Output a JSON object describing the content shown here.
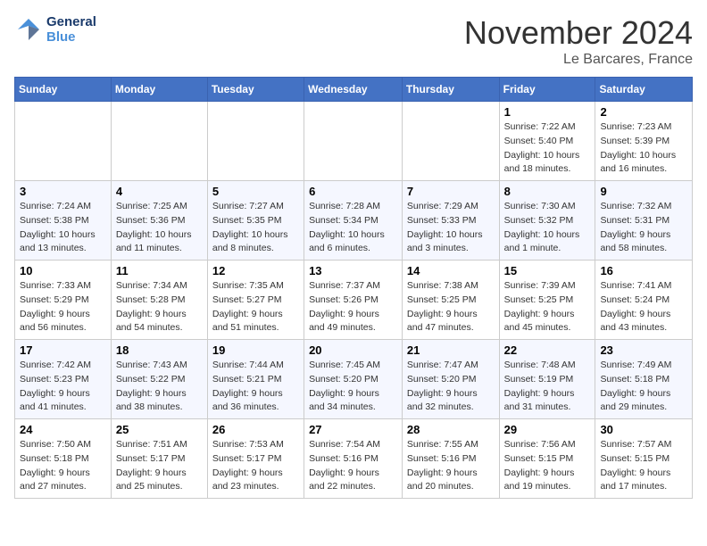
{
  "header": {
    "logo_line1": "General",
    "logo_line2": "Blue",
    "month_title": "November 2024",
    "location": "Le Barcares, France"
  },
  "days_of_week": [
    "Sunday",
    "Monday",
    "Tuesday",
    "Wednesday",
    "Thursday",
    "Friday",
    "Saturday"
  ],
  "weeks": [
    {
      "days": [
        {
          "num": "",
          "info": ""
        },
        {
          "num": "",
          "info": ""
        },
        {
          "num": "",
          "info": ""
        },
        {
          "num": "",
          "info": ""
        },
        {
          "num": "",
          "info": ""
        },
        {
          "num": "1",
          "info": "Sunrise: 7:22 AM\nSunset: 5:40 PM\nDaylight: 10 hours and 18 minutes."
        },
        {
          "num": "2",
          "info": "Sunrise: 7:23 AM\nSunset: 5:39 PM\nDaylight: 10 hours and 16 minutes."
        }
      ]
    },
    {
      "days": [
        {
          "num": "3",
          "info": "Sunrise: 7:24 AM\nSunset: 5:38 PM\nDaylight: 10 hours and 13 minutes."
        },
        {
          "num": "4",
          "info": "Sunrise: 7:25 AM\nSunset: 5:36 PM\nDaylight: 10 hours and 11 minutes."
        },
        {
          "num": "5",
          "info": "Sunrise: 7:27 AM\nSunset: 5:35 PM\nDaylight: 10 hours and 8 minutes."
        },
        {
          "num": "6",
          "info": "Sunrise: 7:28 AM\nSunset: 5:34 PM\nDaylight: 10 hours and 6 minutes."
        },
        {
          "num": "7",
          "info": "Sunrise: 7:29 AM\nSunset: 5:33 PM\nDaylight: 10 hours and 3 minutes."
        },
        {
          "num": "8",
          "info": "Sunrise: 7:30 AM\nSunset: 5:32 PM\nDaylight: 10 hours and 1 minute."
        },
        {
          "num": "9",
          "info": "Sunrise: 7:32 AM\nSunset: 5:31 PM\nDaylight: 9 hours and 58 minutes."
        }
      ]
    },
    {
      "days": [
        {
          "num": "10",
          "info": "Sunrise: 7:33 AM\nSunset: 5:29 PM\nDaylight: 9 hours and 56 minutes."
        },
        {
          "num": "11",
          "info": "Sunrise: 7:34 AM\nSunset: 5:28 PM\nDaylight: 9 hours and 54 minutes."
        },
        {
          "num": "12",
          "info": "Sunrise: 7:35 AM\nSunset: 5:27 PM\nDaylight: 9 hours and 51 minutes."
        },
        {
          "num": "13",
          "info": "Sunrise: 7:37 AM\nSunset: 5:26 PM\nDaylight: 9 hours and 49 minutes."
        },
        {
          "num": "14",
          "info": "Sunrise: 7:38 AM\nSunset: 5:25 PM\nDaylight: 9 hours and 47 minutes."
        },
        {
          "num": "15",
          "info": "Sunrise: 7:39 AM\nSunset: 5:25 PM\nDaylight: 9 hours and 45 minutes."
        },
        {
          "num": "16",
          "info": "Sunrise: 7:41 AM\nSunset: 5:24 PM\nDaylight: 9 hours and 43 minutes."
        }
      ]
    },
    {
      "days": [
        {
          "num": "17",
          "info": "Sunrise: 7:42 AM\nSunset: 5:23 PM\nDaylight: 9 hours and 41 minutes."
        },
        {
          "num": "18",
          "info": "Sunrise: 7:43 AM\nSunset: 5:22 PM\nDaylight: 9 hours and 38 minutes."
        },
        {
          "num": "19",
          "info": "Sunrise: 7:44 AM\nSunset: 5:21 PM\nDaylight: 9 hours and 36 minutes."
        },
        {
          "num": "20",
          "info": "Sunrise: 7:45 AM\nSunset: 5:20 PM\nDaylight: 9 hours and 34 minutes."
        },
        {
          "num": "21",
          "info": "Sunrise: 7:47 AM\nSunset: 5:20 PM\nDaylight: 9 hours and 32 minutes."
        },
        {
          "num": "22",
          "info": "Sunrise: 7:48 AM\nSunset: 5:19 PM\nDaylight: 9 hours and 31 minutes."
        },
        {
          "num": "23",
          "info": "Sunrise: 7:49 AM\nSunset: 5:18 PM\nDaylight: 9 hours and 29 minutes."
        }
      ]
    },
    {
      "days": [
        {
          "num": "24",
          "info": "Sunrise: 7:50 AM\nSunset: 5:18 PM\nDaylight: 9 hours and 27 minutes."
        },
        {
          "num": "25",
          "info": "Sunrise: 7:51 AM\nSunset: 5:17 PM\nDaylight: 9 hours and 25 minutes."
        },
        {
          "num": "26",
          "info": "Sunrise: 7:53 AM\nSunset: 5:17 PM\nDaylight: 9 hours and 23 minutes."
        },
        {
          "num": "27",
          "info": "Sunrise: 7:54 AM\nSunset: 5:16 PM\nDaylight: 9 hours and 22 minutes."
        },
        {
          "num": "28",
          "info": "Sunrise: 7:55 AM\nSunset: 5:16 PM\nDaylight: 9 hours and 20 minutes."
        },
        {
          "num": "29",
          "info": "Sunrise: 7:56 AM\nSunset: 5:15 PM\nDaylight: 9 hours and 19 minutes."
        },
        {
          "num": "30",
          "info": "Sunrise: 7:57 AM\nSunset: 5:15 PM\nDaylight: 9 hours and 17 minutes."
        }
      ]
    }
  ]
}
